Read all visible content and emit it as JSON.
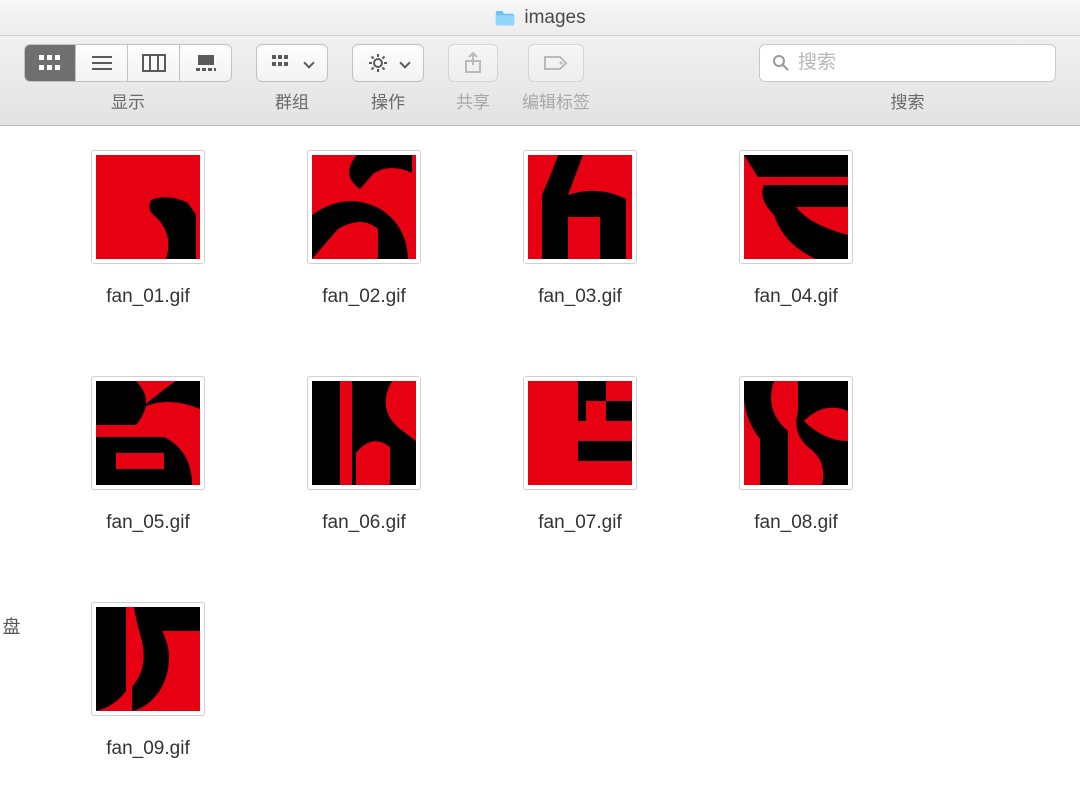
{
  "title": "images",
  "toolbar": {
    "view_label": "显示",
    "group_label": "群组",
    "action_label": "操作",
    "share_label": "共享",
    "tags_label": "编辑标签",
    "search_label": "搜索",
    "search_placeholder": "搜索"
  },
  "icons": {
    "folder": "folder-icon",
    "search": "search-icon",
    "share": "share-icon",
    "tag": "tag-icon",
    "gear": "gear-icon",
    "grid_small": "grid-sort-icon"
  },
  "files": [
    {
      "name": "fan_01.gif"
    },
    {
      "name": "fan_02.gif"
    },
    {
      "name": "fan_03.gif"
    },
    {
      "name": "fan_04.gif"
    },
    {
      "name": "fan_05.gif"
    },
    {
      "name": "fan_06.gif"
    },
    {
      "name": "fan_07.gif"
    },
    {
      "name": "fan_08.gif"
    },
    {
      "name": "fan_09.gif"
    }
  ],
  "colors": {
    "thumb_bg": "#e60012",
    "thumb_fg": "#000000"
  }
}
